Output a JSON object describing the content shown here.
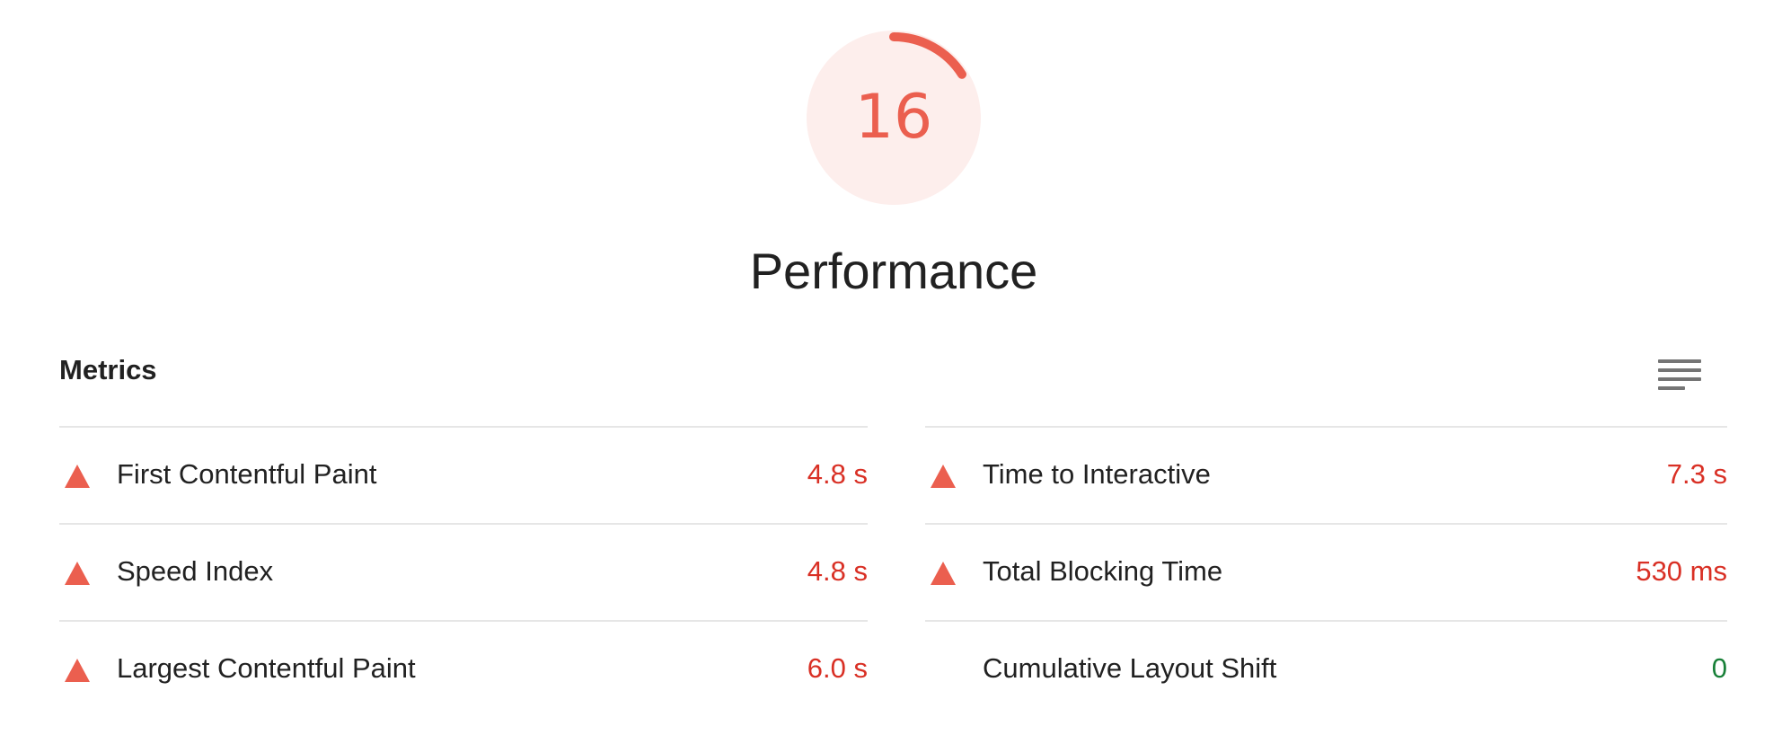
{
  "gauge": {
    "score": "16",
    "score_fraction": 0.16,
    "color": "#eb5f4f",
    "track_color": "#fdeeec"
  },
  "category": {
    "title": "Performance"
  },
  "metrics_section": {
    "header": "Metrics",
    "toggle_icon": "lines-icon"
  },
  "metrics": {
    "left": [
      {
        "label": "First Contentful Paint",
        "value": "4.8 s",
        "status": "fail"
      },
      {
        "label": "Speed Index",
        "value": "4.8 s",
        "status": "fail"
      },
      {
        "label": "Largest Contentful Paint",
        "value": "6.0 s",
        "status": "fail"
      }
    ],
    "right": [
      {
        "label": "Time to Interactive",
        "value": "7.3 s",
        "status": "fail"
      },
      {
        "label": "Total Blocking Time",
        "value": "530 ms",
        "status": "fail"
      },
      {
        "label": "Cumulative Layout Shift",
        "value": "0",
        "status": "pass"
      }
    ]
  },
  "colors": {
    "fail_icon": "#eb5f4f",
    "fail_text": "#d93025",
    "pass_text": "#188038",
    "divider": "#e6e6e6"
  }
}
